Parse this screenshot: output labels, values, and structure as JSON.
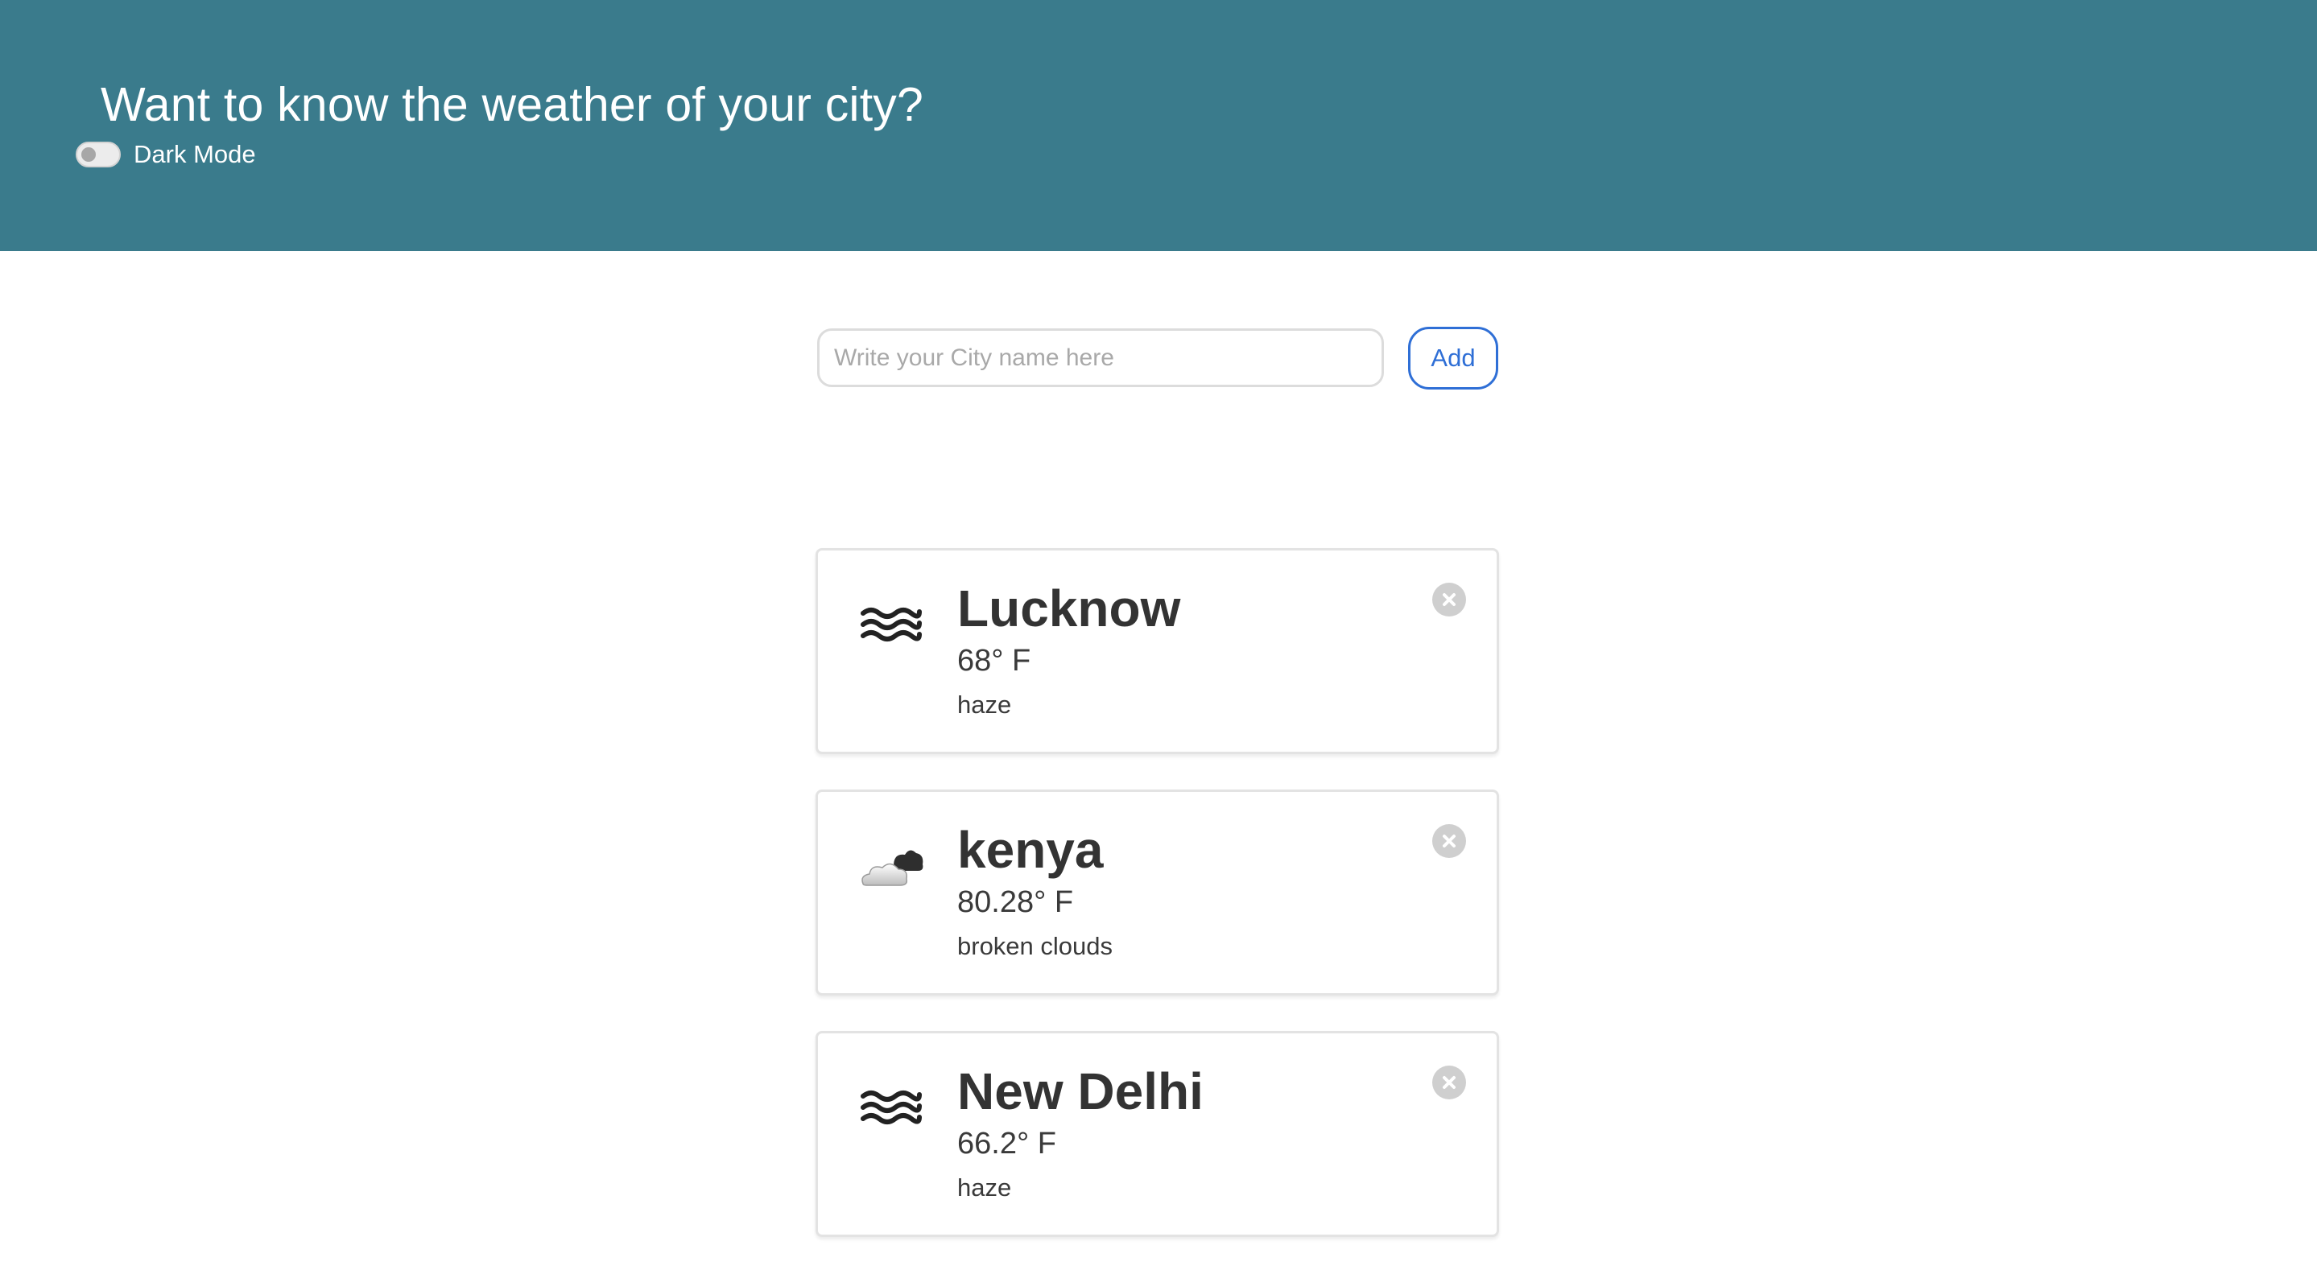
{
  "header": {
    "title": "Want to know the weather of your city?",
    "dark_mode_label": "Dark Mode",
    "dark_mode_enabled": false,
    "background_color": "#3a7b8c"
  },
  "search": {
    "placeholder": "Write your City name here",
    "value": "",
    "add_label": "Add",
    "accent_color": "#2f6fd6"
  },
  "cities": [
    {
      "name": "Lucknow",
      "temp": "68° F",
      "description": "haze",
      "icon": "haze-icon"
    },
    {
      "name": "kenya",
      "temp": "80.28° F",
      "description": "broken clouds",
      "icon": "broken-clouds-icon"
    },
    {
      "name": "New Delhi",
      "temp": "66.2° F",
      "description": "haze",
      "icon": "haze-icon"
    }
  ]
}
